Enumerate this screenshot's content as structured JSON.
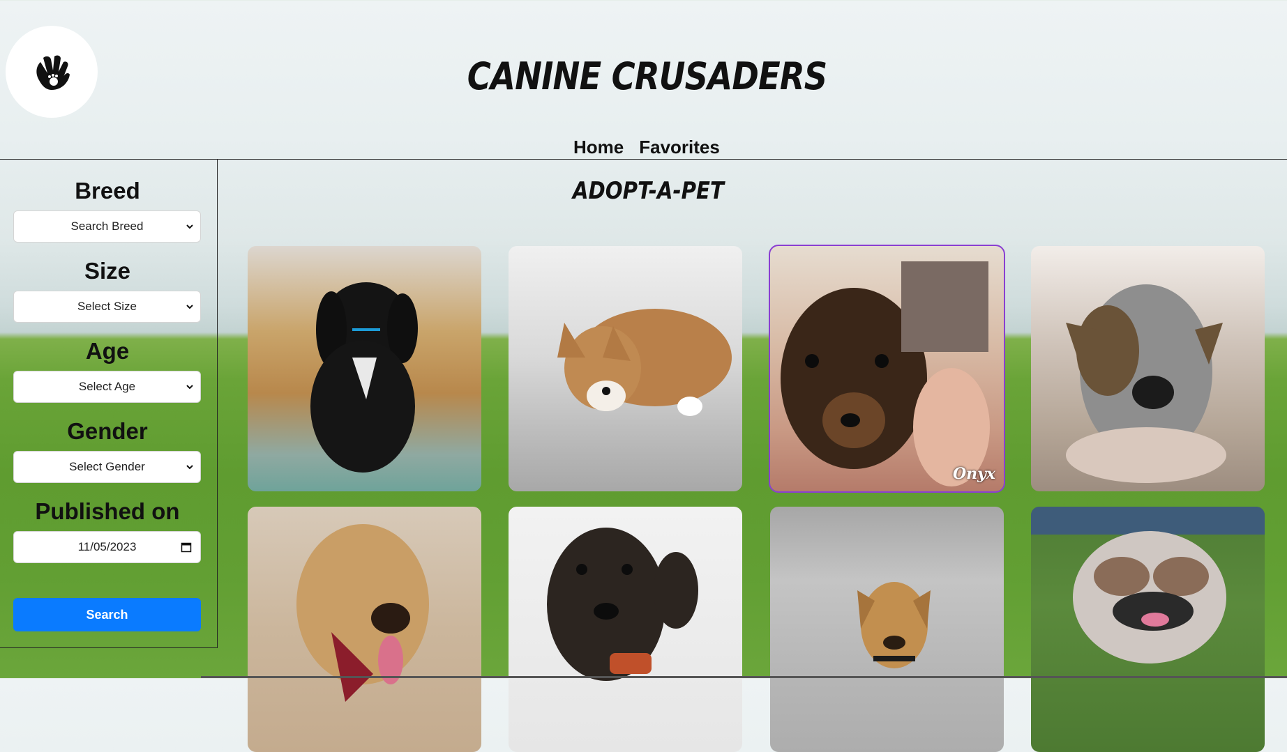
{
  "header": {
    "title": "CANINE CRUSADERS",
    "logo_icon": "hand-paw-icon",
    "nav": [
      {
        "label": "Home"
      },
      {
        "label": "Favorites"
      }
    ]
  },
  "sidebar": {
    "breed": {
      "label": "Breed",
      "value": "Search Breed"
    },
    "size": {
      "label": "Size",
      "value": "Select Size"
    },
    "age": {
      "label": "Age",
      "value": "Select Age"
    },
    "gender": {
      "label": "Gender",
      "value": "Select Gender"
    },
    "published": {
      "label": "Published on",
      "value": "11/05/2023"
    },
    "search_label": "Search"
  },
  "main": {
    "title": "ADOPT-A-PET",
    "cards": [
      {
        "caption": ""
      },
      {
        "caption": ""
      },
      {
        "caption": "Onyx"
      },
      {
        "caption": ""
      },
      {
        "caption": ""
      },
      {
        "caption": ""
      },
      {
        "caption": ""
      },
      {
        "caption": ""
      }
    ]
  },
  "colors": {
    "accent": "#0a7bff",
    "selected_outline": "#8a3fd1"
  }
}
